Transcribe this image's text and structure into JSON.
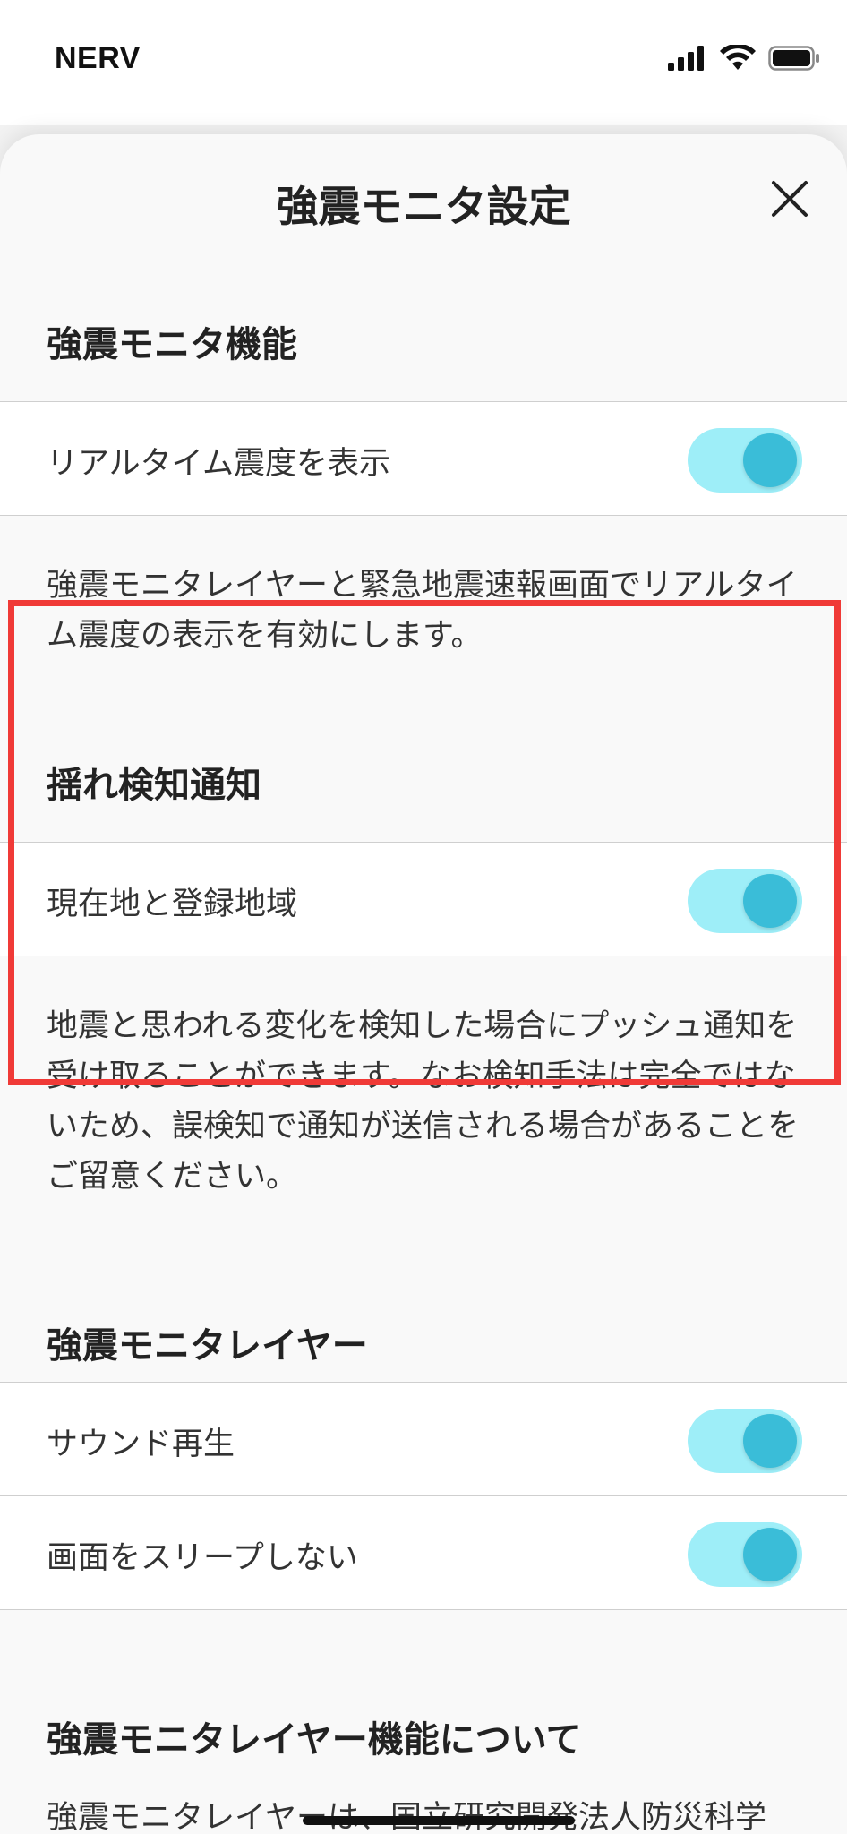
{
  "status_bar": {
    "carrier": "NERV"
  },
  "sheet": {
    "title": "強震モニタ設定",
    "close_icon": "close-icon"
  },
  "sections": {
    "monitor_function": {
      "header": "強震モニタ機能",
      "row_label": "リアルタイム震度を表示",
      "toggle_on": true,
      "description": "強震モニタレイヤーと緊急地震速報画面でリアルタイム震度の表示を有効にします。"
    },
    "shake_notification": {
      "header": "揺れ検知通知",
      "row_label": "現在地と登録地域",
      "toggle_on": true,
      "description": "地震と思われる変化を検知した場合にプッシュ通知を受け取ることができます。なお検知手法は完全ではないため、誤検知で通知が送信される場合があることをご留意ください。"
    },
    "monitor_layer": {
      "header": "強震モニタレイヤー",
      "rows": [
        {
          "label": "サウンド再生",
          "toggle_on": true
        },
        {
          "label": "画面をスリープしない",
          "toggle_on": true
        }
      ]
    },
    "about": {
      "header": "強震モニタレイヤー機能について",
      "description": "強震モニタレイヤーは、国立研究開発法人防災科学"
    }
  },
  "colors": {
    "toggle_track": "#9eeef8",
    "toggle_knob": "#3abdd8",
    "highlight": "#f03a37"
  }
}
